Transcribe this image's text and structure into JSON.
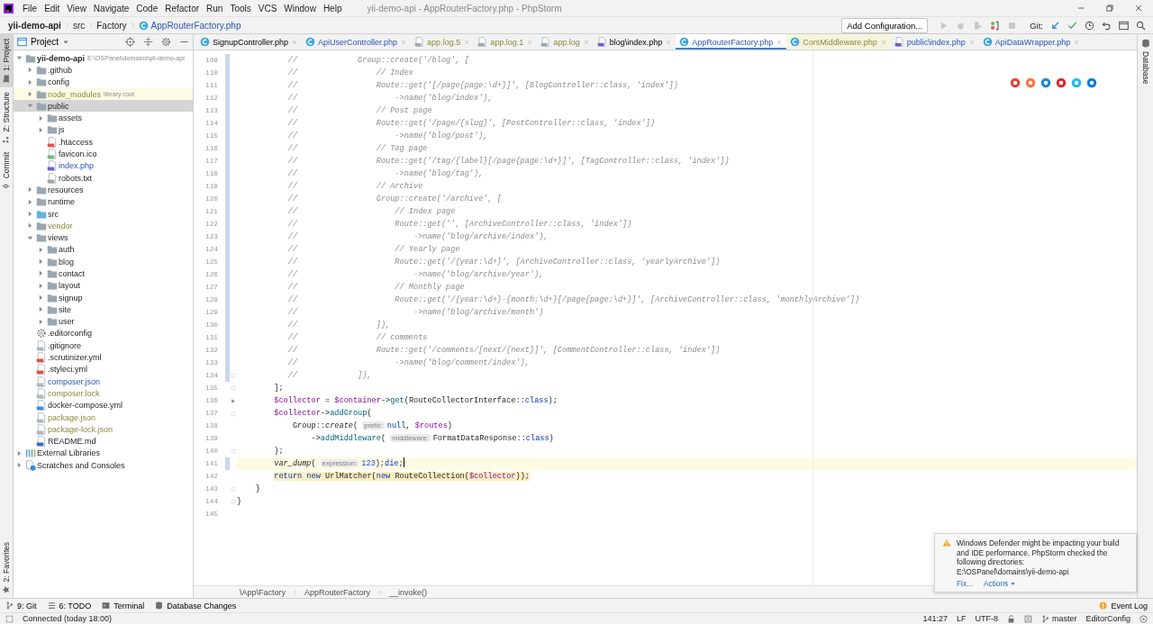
{
  "menu": [
    "File",
    "Edit",
    "View",
    "Navigate",
    "Code",
    "Refactor",
    "Run",
    "Tools",
    "VCS",
    "Window",
    "Help"
  ],
  "window_title": "yii-demo-api - AppRouterFactory.php - PhpStorm",
  "navigation_bar": [
    {
      "kind": "project",
      "text": "yii-demo-api"
    },
    {
      "kind": "folder",
      "text": "src"
    },
    {
      "kind": "folder",
      "text": "Factory"
    },
    {
      "kind": "class",
      "text": "AppRouterFactory.php"
    }
  ],
  "toolbar": {
    "run_configuration": "Add Configuration...",
    "vcs_label": "Git:"
  },
  "left_tool_windows": [
    {
      "kind": "project",
      "label": "1: Project",
      "selected": true
    },
    {
      "kind": "structure",
      "label": "Z: Structure",
      "selected": false
    },
    {
      "kind": "commit",
      "label": "Commit",
      "selected": false
    }
  ],
  "left_bottom_tool_windows": [
    {
      "kind": "favorites",
      "label": "2: Favorites",
      "selected": false
    }
  ],
  "right_tool_windows": [
    {
      "kind": "database",
      "label": "Database",
      "selected": false
    }
  ],
  "project_panel": {
    "title": "Project",
    "tree": [
      {
        "name": "yii-demo-api",
        "detail": "E:\\OSPanel\\domains\\yii-demo-api",
        "kind": "folder",
        "modified": false,
        "ignored": false,
        "expanded": true,
        "selected": false,
        "highlighted": false,
        "children": [
          {
            "name": ".github",
            "kind": "folder",
            "modified": false,
            "ignored": false,
            "expanded": false,
            "selected": false,
            "highlighted": false
          },
          {
            "name": "config",
            "kind": "folder",
            "modified": false,
            "ignored": false,
            "expanded": false,
            "selected": false,
            "highlighted": false
          },
          {
            "name": "node_modules",
            "detail": "library root",
            "kind": "folder",
            "modified": false,
            "ignored": true,
            "expanded": false,
            "selected": false,
            "highlighted": true
          },
          {
            "name": "public",
            "kind": "folder",
            "modified": false,
            "ignored": false,
            "expanded": true,
            "selected": true,
            "highlighted": false,
            "children": [
              {
                "name": "assets",
                "kind": "folder",
                "modified": false,
                "ignored": false,
                "expanded": false,
                "selected": false,
                "highlighted": false
              },
              {
                "name": "js",
                "kind": "folder",
                "modified": false,
                "ignored": false,
                "expanded": false,
                "selected": false,
                "highlighted": false
              },
              {
                "name": ".htaccess",
                "kind": "htaccess",
                "modified": false,
                "ignored": false,
                "selected": false,
                "highlighted": false
              },
              {
                "name": "favicon.ico",
                "kind": "image",
                "modified": false,
                "ignored": false,
                "selected": false,
                "highlighted": false
              },
              {
                "name": "index.php",
                "kind": "php",
                "modified": true,
                "ignored": false,
                "selected": false,
                "highlighted": false
              },
              {
                "name": "robots.txt",
                "kind": "text",
                "modified": false,
                "ignored": false,
                "selected": false,
                "highlighted": false
              }
            ]
          },
          {
            "name": "resources",
            "kind": "folder",
            "modified": false,
            "ignored": false,
            "expanded": false,
            "selected": false,
            "highlighted": false
          },
          {
            "name": "runtime",
            "kind": "folder",
            "modified": false,
            "ignored": false,
            "expanded": false,
            "selected": false,
            "highlighted": false
          },
          {
            "name": "src",
            "kind": "source-folder",
            "modified": false,
            "ignored": false,
            "expanded": false,
            "selected": false,
            "highlighted": false
          },
          {
            "name": "vendor",
            "kind": "folder",
            "modified": false,
            "ignored": true,
            "expanded": false,
            "selected": false,
            "highlighted": false
          },
          {
            "name": "views",
            "kind": "folder",
            "modified": false,
            "ignored": false,
            "expanded": true,
            "selected": false,
            "highlighted": false,
            "children": [
              {
                "name": "auth",
                "kind": "folder",
                "modified": false,
                "ignored": false,
                "expanded": false,
                "selected": false,
                "highlighted": false
              },
              {
                "name": "blog",
                "kind": "folder",
                "modified": false,
                "ignored": false,
                "expanded": false,
                "selected": false,
                "highlighted": false
              },
              {
                "name": "contact",
                "kind": "folder",
                "modified": false,
                "ignored": false,
                "expanded": false,
                "selected": false,
                "highlighted": false
              },
              {
                "name": "layout",
                "kind": "folder",
                "modified": false,
                "ignored": false,
                "expanded": false,
                "selected": false,
                "highlighted": false
              },
              {
                "name": "signup",
                "kind": "folder",
                "modified": false,
                "ignored": false,
                "expanded": false,
                "selected": false,
                "highlighted": false
              },
              {
                "name": "site",
                "kind": "folder",
                "modified": false,
                "ignored": false,
                "expanded": false,
                "selected": false,
                "highlighted": false
              },
              {
                "name": "user",
                "kind": "folder",
                "modified": false,
                "ignored": false,
                "expanded": false,
                "selected": false,
                "highlighted": false
              }
            ]
          },
          {
            "name": ".editorconfig",
            "kind": "config",
            "modified": false,
            "ignored": false,
            "selected": false,
            "highlighted": false
          },
          {
            "name": ".gitignore",
            "kind": "json",
            "modified": false,
            "ignored": false,
            "selected": false,
            "highlighted": false
          },
          {
            "name": ".scrutinizer.yml",
            "kind": "yml",
            "modified": false,
            "ignored": false,
            "selected": false,
            "highlighted": false
          },
          {
            "name": ".styleci.yml",
            "kind": "yml",
            "modified": false,
            "ignored": false,
            "selected": false,
            "highlighted": false
          },
          {
            "name": "composer.json",
            "kind": "json",
            "modified": true,
            "ignored": false,
            "selected": false,
            "highlighted": false
          },
          {
            "name": "composer.lock",
            "kind": "json",
            "modified": false,
            "ignored": true,
            "selected": false,
            "highlighted": false
          },
          {
            "name": "docker-compose.yml",
            "kind": "docker",
            "modified": false,
            "ignored": false,
            "selected": false,
            "highlighted": false
          },
          {
            "name": "package.json",
            "kind": "json",
            "modified": false,
            "ignored": true,
            "selected": false,
            "highlighted": false
          },
          {
            "name": "package-lock.json",
            "kind": "json",
            "modified": false,
            "ignored": true,
            "selected": false,
            "highlighted": false
          },
          {
            "name": "README.md",
            "kind": "md",
            "modified": false,
            "ignored": false,
            "selected": false,
            "highlighted": false
          }
        ]
      },
      {
        "name": "External Libraries",
        "kind": "libraries",
        "modified": false,
        "ignored": false,
        "expanded": false,
        "selected": false,
        "highlighted": false
      },
      {
        "name": "Scratches and Consoles",
        "kind": "scratches",
        "modified": false,
        "ignored": false,
        "expanded": false,
        "selected": false,
        "highlighted": false
      }
    ]
  },
  "tabs": [
    {
      "label": "SignupController.php",
      "kind": "class",
      "modified": false,
      "ignored": false,
      "selected": false,
      "highlighted": false
    },
    {
      "label": "ApiUserController.php",
      "kind": "class",
      "modified": true,
      "ignored": false,
      "selected": false,
      "highlighted": false
    },
    {
      "label": "app.log.5",
      "kind": "log",
      "modified": false,
      "ignored": true,
      "selected": false,
      "highlighted": false
    },
    {
      "label": "app.log.1",
      "kind": "log",
      "modified": false,
      "ignored": true,
      "selected": false,
      "highlighted": false
    },
    {
      "label": "app.log",
      "kind": "log",
      "modified": false,
      "ignored": true,
      "selected": false,
      "highlighted": false
    },
    {
      "label": "blog\\index.php",
      "kind": "php",
      "modified": false,
      "ignored": false,
      "selected": false,
      "highlighted": false
    },
    {
      "label": "AppRouterFactory.php",
      "kind": "class",
      "modified": true,
      "ignored": false,
      "selected": true,
      "highlighted": false
    },
    {
      "label": "CorsMiddleware.php",
      "kind": "class",
      "modified": false,
      "ignored": true,
      "selected": false,
      "highlighted": true
    },
    {
      "label": "public\\index.php",
      "kind": "php",
      "modified": true,
      "ignored": false,
      "selected": false,
      "highlighted": false
    },
    {
      "label": "ApiDataWrapper.php",
      "kind": "class",
      "modified": true,
      "ignored": false,
      "selected": false,
      "highlighted": false
    }
  ],
  "editor": {
    "lines": [
      {
        "number": "109",
        "kind": "plain",
        "changed": true,
        "current": false,
        "warning": false,
        "tokens": [
          {
            "kind": "comment",
            "text": "           //             Group::create('/blog', ["
          }
        ]
      },
      {
        "number": "110",
        "kind": "plain",
        "changed": true,
        "current": false,
        "warning": false,
        "tokens": [
          {
            "kind": "comment",
            "text": "           //                 // Index"
          }
        ]
      },
      {
        "number": "111",
        "kind": "plain",
        "changed": true,
        "current": false,
        "warning": false,
        "tokens": [
          {
            "kind": "comment",
            "text": "           //                 Route::get('[/page{page:\\d+}]', [BlogController::class, 'index'])"
          }
        ]
      },
      {
        "number": "112",
        "kind": "plain",
        "changed": true,
        "current": false,
        "warning": false,
        "tokens": [
          {
            "kind": "comment",
            "text": "           //                     ->name('blog/index'),"
          }
        ]
      },
      {
        "number": "113",
        "kind": "plain",
        "changed": true,
        "current": false,
        "warning": false,
        "tokens": [
          {
            "kind": "comment",
            "text": "           //                 // Post page"
          }
        ]
      },
      {
        "number": "114",
        "kind": "plain",
        "changed": true,
        "current": false,
        "warning": false,
        "tokens": [
          {
            "kind": "comment",
            "text": "           //                 Route::get('/page/{slug}', [PostController::class, 'index'])"
          }
        ]
      },
      {
        "number": "115",
        "kind": "plain",
        "changed": true,
        "current": false,
        "warning": false,
        "tokens": [
          {
            "kind": "comment",
            "text": "           //                     ->name('blog/post'),"
          }
        ]
      },
      {
        "number": "116",
        "kind": "plain",
        "changed": true,
        "current": false,
        "warning": false,
        "tokens": [
          {
            "kind": "comment",
            "text": "           //                 // Tag page"
          }
        ]
      },
      {
        "number": "117",
        "kind": "plain",
        "changed": true,
        "current": false,
        "warning": false,
        "tokens": [
          {
            "kind": "comment",
            "text": "           //                 Route::get('/tag/{label}[/page{page:\\d+}]', [TagController::class, 'index'])"
          }
        ]
      },
      {
        "number": "118",
        "kind": "plain",
        "changed": true,
        "current": false,
        "warning": false,
        "tokens": [
          {
            "kind": "comment",
            "text": "           //                     ->name('blog/tag'),"
          }
        ]
      },
      {
        "number": "119",
        "kind": "plain",
        "changed": true,
        "current": false,
        "warning": false,
        "tokens": [
          {
            "kind": "comment",
            "text": "           //                 // Archive"
          }
        ]
      },
      {
        "number": "120",
        "kind": "plain",
        "changed": true,
        "current": false,
        "warning": false,
        "tokens": [
          {
            "kind": "comment",
            "text": "           //                 Group::create('/archive', ["
          }
        ]
      },
      {
        "number": "121",
        "kind": "plain",
        "changed": true,
        "current": false,
        "warning": false,
        "tokens": [
          {
            "kind": "comment",
            "text": "           //                     // Index page"
          }
        ]
      },
      {
        "number": "122",
        "kind": "plain",
        "changed": true,
        "current": false,
        "warning": false,
        "tokens": [
          {
            "kind": "comment",
            "text": "           //                     Route::get('', [ArchiveController::class, 'index'])"
          }
        ]
      },
      {
        "number": "123",
        "kind": "plain",
        "changed": true,
        "current": false,
        "warning": false,
        "tokens": [
          {
            "kind": "comment",
            "text": "           //                         ->name('blog/archive/index'),"
          }
        ]
      },
      {
        "number": "124",
        "kind": "plain",
        "changed": true,
        "current": false,
        "warning": false,
        "tokens": [
          {
            "kind": "comment",
            "text": "           //                     // Yearly page"
          }
        ]
      },
      {
        "number": "125",
        "kind": "plain",
        "changed": true,
        "current": false,
        "warning": false,
        "tokens": [
          {
            "kind": "comment",
            "text": "           //                     Route::get('/{year:\\d+}', [ArchiveController::class, 'yearlyArchive'])"
          }
        ]
      },
      {
        "number": "126",
        "kind": "plain",
        "changed": true,
        "current": false,
        "warning": false,
        "tokens": [
          {
            "kind": "comment",
            "text": "           //                         ->name('blog/archive/year'),"
          }
        ]
      },
      {
        "number": "127",
        "kind": "plain",
        "changed": true,
        "current": false,
        "warning": false,
        "tokens": [
          {
            "kind": "comment",
            "text": "           //                     // Monthly page"
          }
        ]
      },
      {
        "number": "128",
        "kind": "plain",
        "changed": true,
        "current": false,
        "warning": false,
        "tokens": [
          {
            "kind": "comment",
            "text": "           //                     Route::get('/{year:\\d+}-{month:\\d+}[/page{page:\\d+}]', [ArchiveController::class, 'monthlyArchive'])"
          }
        ]
      },
      {
        "number": "129",
        "kind": "plain",
        "changed": true,
        "current": false,
        "warning": false,
        "tokens": [
          {
            "kind": "comment",
            "text": "           //                         ->name('blog/archive/month')"
          }
        ]
      },
      {
        "number": "130",
        "kind": "plain",
        "changed": true,
        "current": false,
        "warning": false,
        "tokens": [
          {
            "kind": "comment",
            "text": "           //                 ]),"
          }
        ]
      },
      {
        "number": "131",
        "kind": "plain",
        "changed": true,
        "current": false,
        "warning": false,
        "tokens": [
          {
            "kind": "comment",
            "text": "           //                 // comments"
          }
        ]
      },
      {
        "number": "132",
        "kind": "plain",
        "changed": true,
        "current": false,
        "warning": false,
        "tokens": [
          {
            "kind": "comment",
            "text": "           //                 Route::get('/comments/[next/{next}]', [CommentController::class, 'index'])"
          }
        ]
      },
      {
        "number": "133",
        "kind": "plain",
        "changed": true,
        "current": false,
        "warning": false,
        "tokens": [
          {
            "kind": "comment",
            "text": "           //                     ->name('blog/comment/index'),"
          }
        ]
      },
      {
        "number": "134",
        "kind": "fold-end",
        "changed": true,
        "current": false,
        "warning": false,
        "tokens": [
          {
            "kind": "comment",
            "text": "           //             ]),"
          }
        ]
      },
      {
        "number": "135",
        "kind": "fold-end",
        "changed": false,
        "current": false,
        "warning": false,
        "tokens": [
          {
            "kind": "plain",
            "text": "        ];"
          }
        ]
      },
      {
        "number": "136",
        "kind": "arrow",
        "changed": false,
        "current": false,
        "warning": false,
        "tokens": [
          {
            "kind": "var",
            "text": "        $collector"
          },
          {
            "kind": "plain",
            "text": " = "
          },
          {
            "kind": "var",
            "text": "$container"
          },
          {
            "kind": "plain",
            "text": "->"
          },
          {
            "kind": "method",
            "text": "get"
          },
          {
            "kind": "plain",
            "text": "(RouteCollectorInterface::"
          },
          {
            "kind": "keyword",
            "text": "class"
          },
          {
            "kind": "plain",
            "text": ");"
          }
        ]
      },
      {
        "number": "137",
        "kind": "fold-start",
        "changed": false,
        "current": false,
        "warning": false,
        "tokens": [
          {
            "kind": "var",
            "text": "        $collector"
          },
          {
            "kind": "plain",
            "text": "->"
          },
          {
            "kind": "method",
            "text": "addGroup"
          },
          {
            "kind": "plain",
            "text": "("
          }
        ]
      },
      {
        "number": "138",
        "kind": "plain",
        "changed": false,
        "current": false,
        "warning": false,
        "tokens": [
          {
            "kind": "plain",
            "text": "            Group::"
          },
          {
            "kind": "italic",
            "text": "create"
          },
          {
            "kind": "plain",
            "text": "( "
          },
          {
            "kind": "hint",
            "text": "prefix:"
          },
          {
            "kind": "keyword",
            "text": "null"
          },
          {
            "kind": "plain",
            "text": ", "
          },
          {
            "kind": "var",
            "text": "$routes"
          },
          {
            "kind": "plain",
            "text": ")"
          }
        ]
      },
      {
        "number": "139",
        "kind": "plain",
        "changed": false,
        "current": false,
        "warning": false,
        "tokens": [
          {
            "kind": "plain",
            "text": "                ->"
          },
          {
            "kind": "method",
            "text": "addMiddleware"
          },
          {
            "kind": "plain",
            "text": "( "
          },
          {
            "kind": "hint",
            "text": "middleware:"
          },
          {
            "kind": "plain",
            "text": "FormatDataResponse::"
          },
          {
            "kind": "keyword",
            "text": "class"
          },
          {
            "kind": "plain",
            "text": ")"
          }
        ]
      },
      {
        "number": "140",
        "kind": "fold-end",
        "changed": false,
        "current": false,
        "warning": false,
        "tokens": [
          {
            "kind": "plain",
            "text": "        );"
          }
        ]
      },
      {
        "number": "141",
        "kind": "plain",
        "changed": true,
        "current": true,
        "warning": false,
        "tokens": [
          {
            "kind": "italic",
            "text": "        var_dump"
          },
          {
            "kind": "plain",
            "text": "( "
          },
          {
            "kind": "hint",
            "text": "expression:"
          },
          {
            "kind": "number",
            "text": "123"
          },
          {
            "kind": "plain",
            "text": ");"
          },
          {
            "kind": "keyword",
            "text": "die"
          },
          {
            "kind": "plain",
            "text": ";"
          }
        ]
      },
      {
        "number": "142",
        "kind": "plain",
        "changed": false,
        "current": false,
        "warning": true,
        "tokens": [
          {
            "kind": "keyword",
            "text": "        return new "
          },
          {
            "kind": "plain",
            "text": "UrlMatcher("
          },
          {
            "kind": "keyword",
            "text": "new "
          },
          {
            "kind": "plain",
            "text": "RouteCollection("
          },
          {
            "kind": "var",
            "text": "$collector"
          },
          {
            "kind": "plain",
            "text": "));"
          }
        ]
      },
      {
        "number": "143",
        "kind": "fold-end",
        "changed": false,
        "current": false,
        "warning": false,
        "tokens": [
          {
            "kind": "plain",
            "text": "    }"
          }
        ]
      },
      {
        "number": "144",
        "kind": "fold-end",
        "changed": false,
        "current": false,
        "warning": false,
        "tokens": [
          {
            "kind": "plain",
            "text": "}"
          }
        ]
      },
      {
        "number": "145",
        "kind": "plain",
        "changed": false
      }
    ],
    "breadcrumb": [
      "\\App\\Factory",
      "AppRouterFactory",
      "__invoke()"
    ]
  },
  "notification": {
    "message": "Windows Defender might be impacting your build and IDE performance. PhpStorm checked the following directories:",
    "path": "E:\\OSPanel\\domains\\yii-demo-api",
    "links": [
      {
        "kind": "plain",
        "text": "Fix..."
      },
      {
        "kind": "menu",
        "text": "Actions"
      }
    ]
  },
  "tool_buttons": [
    {
      "kind": "git",
      "label": "9: Git"
    },
    {
      "kind": "todo",
      "label": "6: TODO"
    },
    {
      "kind": "terminal",
      "label": "Terminal"
    },
    {
      "kind": "database",
      "label": "Database Changes"
    }
  ],
  "event_log": "Event Log",
  "status_bar": {
    "message": "Connected (today 18:00)",
    "position": "141:27",
    "line_separator": "LF",
    "encoding": "UTF-8",
    "branch": "master",
    "code_style": "EditorConfig"
  }
}
